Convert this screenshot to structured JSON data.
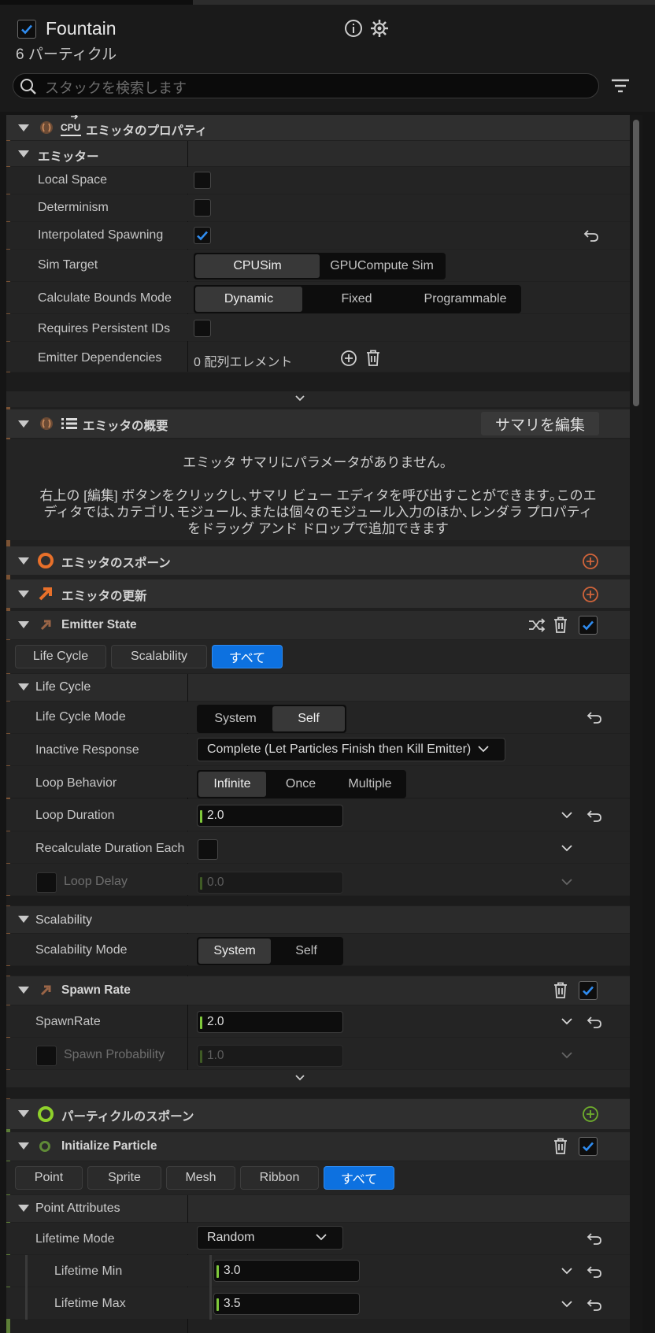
{
  "header": {
    "emitter_name": "Fountain",
    "particle_count": "6 パーティクル",
    "search_placeholder": "スタックを検索します"
  },
  "emitter_properties": {
    "title": "エミッタのプロパティ",
    "cpu_badge": "CPU",
    "group": "エミッター",
    "local_space": "Local Space",
    "determinism": "Determinism",
    "interpolated_spawning": "Interpolated Spawning",
    "sim_target": "Sim Target",
    "sim_target_options": [
      "CPUSim",
      "GPUCompute Sim"
    ],
    "calc_bounds_mode": "Calculate Bounds Mode",
    "calc_bounds_options": [
      "Dynamic",
      "Fixed",
      "Programmable"
    ],
    "requires_persistent_ids": "Requires Persistent IDs",
    "emitter_dependencies": "Emitter Dependencies",
    "dependencies_value": "0 配列エレメント"
  },
  "emitter_summary": {
    "title": "エミッタの概要",
    "edit_button": "サマリを編集",
    "empty_message": "エミッタ サマリにパラメータがありません。",
    "help_line1": "右上の [編集] ボタンをクリックし､サマリ ビュー エディタを呼び出すことができます｡このエ",
    "help_line2": "ディタでは､カテゴリ､モジュール､または個々のモジュール入力のほか､レンダラ プロパティ",
    "help_line3": "をドラッグ アンド ドロップで追加できます"
  },
  "emitter_spawn": {
    "title": "エミッタのスポーン"
  },
  "emitter_update": {
    "title": "エミッタの更新"
  },
  "emitter_state": {
    "title": "Emitter State",
    "tabs": [
      "Life Cycle",
      "Scalability",
      "すべて"
    ],
    "life_cycle_group": "Life Cycle",
    "life_cycle_mode": "Life Cycle Mode",
    "life_cycle_mode_options": [
      "System",
      "Self"
    ],
    "inactive_response": "Inactive Response",
    "inactive_response_value": "Complete (Let Particles Finish then Kill Emitter)",
    "loop_behavior": "Loop Behavior",
    "loop_behavior_options": [
      "Infinite",
      "Once",
      "Multiple"
    ],
    "loop_duration": "Loop Duration",
    "loop_duration_value": "2.0",
    "recalculate_duration": "Recalculate Duration Each",
    "loop_delay": "Loop Delay",
    "loop_delay_value": "0.0",
    "scalability_group": "Scalability",
    "scalability_mode": "Scalability Mode",
    "scalability_mode_options": [
      "System",
      "Self"
    ]
  },
  "spawn_rate": {
    "title": "Spawn Rate",
    "spawn_rate_label": "SpawnRate",
    "spawn_rate_value": "2.0",
    "spawn_probability": "Spawn Probability",
    "spawn_probability_value": "1.0"
  },
  "particle_spawn": {
    "title": "パーティクルのスポーン"
  },
  "initialize_particle": {
    "title": "Initialize Particle",
    "tabs": [
      "Point",
      "Sprite",
      "Mesh",
      "Ribbon",
      "すべて"
    ],
    "point_attributes": "Point Attributes",
    "lifetime_mode": "Lifetime Mode",
    "lifetime_mode_value": "Random",
    "lifetime_min": "Lifetime Min",
    "lifetime_min_value": "3.0",
    "lifetime_max": "Lifetime Max",
    "lifetime_max_value": "3.5"
  },
  "colors": {
    "accent_blue": "#0d71e0",
    "emitter_stripe": "#7a5234",
    "particle_stripe": "#5d7f37",
    "orange_icon": "#e8702a",
    "green_icon": "#8fd12b"
  }
}
